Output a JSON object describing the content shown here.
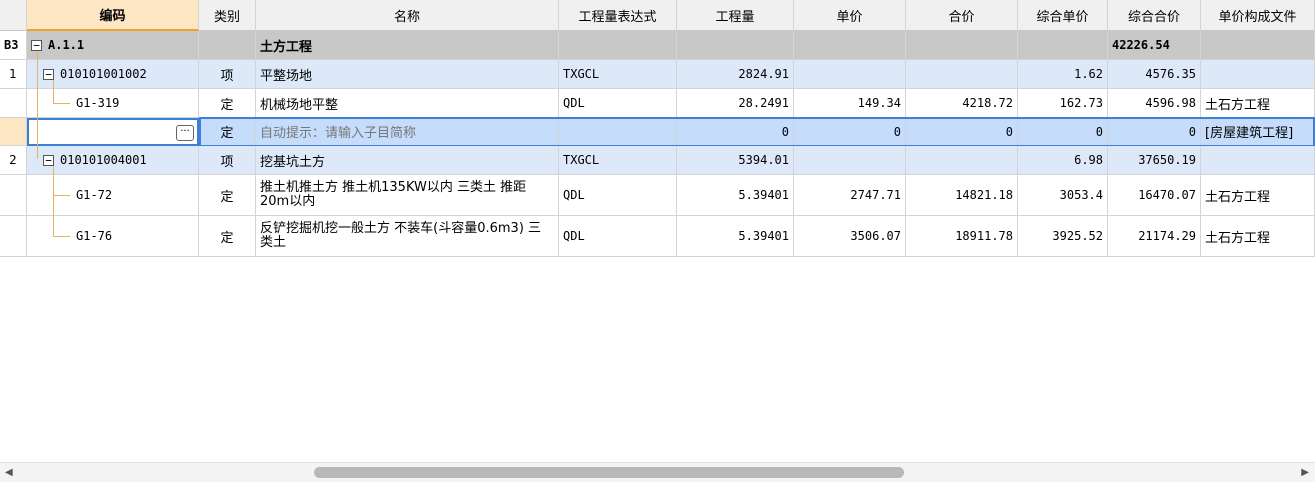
{
  "headers": [
    "",
    "编码",
    "类别",
    "名称",
    "工程量表达式",
    "工程量",
    "单价",
    "合价",
    "综合单价",
    "综合合价",
    "单价构成文件"
  ],
  "group": {
    "rowhdr": "B3",
    "code": "A.1.1",
    "name": "土方工程",
    "total": "42226.54"
  },
  "row1": {
    "rowhdr": "1",
    "code": "010101001002",
    "type": "项",
    "name": "平整场地",
    "expr": "TXGCL",
    "qty": "2824.91",
    "uprice": "",
    "price": "",
    "cunit": "1.62",
    "ctotal": "4576.35",
    "file": ""
  },
  "row2": {
    "rowhdr": "",
    "code": "G1-319",
    "type": "定",
    "name": "机械场地平整",
    "expr": "QDL",
    "qty": "28.2491",
    "uprice": "149.34",
    "price": "4218.72",
    "cunit": "162.73",
    "ctotal": "4596.98",
    "file": "土石方工程"
  },
  "row3": {
    "rowhdr": "",
    "code": "",
    "type": "定",
    "name": "自动提示：请输入子目简称",
    "expr": "",
    "qty": "0",
    "uprice": "0",
    "price": "0",
    "cunit": "0",
    "ctotal": "0",
    "file": "[房屋建筑工程]",
    "button": "···"
  },
  "row4": {
    "rowhdr": "2",
    "code": "010101004001",
    "type": "项",
    "name": "挖基坑土方",
    "expr": "TXGCL",
    "qty": "5394.01",
    "uprice": "",
    "price": "",
    "cunit": "6.98",
    "ctotal": "37650.19",
    "file": ""
  },
  "row5": {
    "rowhdr": "",
    "code": "G1-72",
    "type": "定",
    "name": "推土机推土方 推土机135KW以内 三类土 推距20m以内",
    "expr": "QDL",
    "qty": "5.39401",
    "uprice": "2747.71",
    "price": "14821.18",
    "cunit": "3053.4",
    "ctotal": "16470.07",
    "file": "土石方工程"
  },
  "row6": {
    "rowhdr": "",
    "code": "G1-76",
    "type": "定",
    "name": "反铲挖掘机挖一般土方 不装车(斗容量0.6m3) 三类土",
    "expr": "QDL",
    "qty": "5.39401",
    "uprice": "3506.07",
    "price": "18911.78",
    "cunit": "3925.52",
    "ctotal": "21174.29",
    "file": "土石方工程"
  },
  "toggle_symbol": "−",
  "scroll": {
    "left_arrow": "◀",
    "right_arrow": "▶"
  }
}
